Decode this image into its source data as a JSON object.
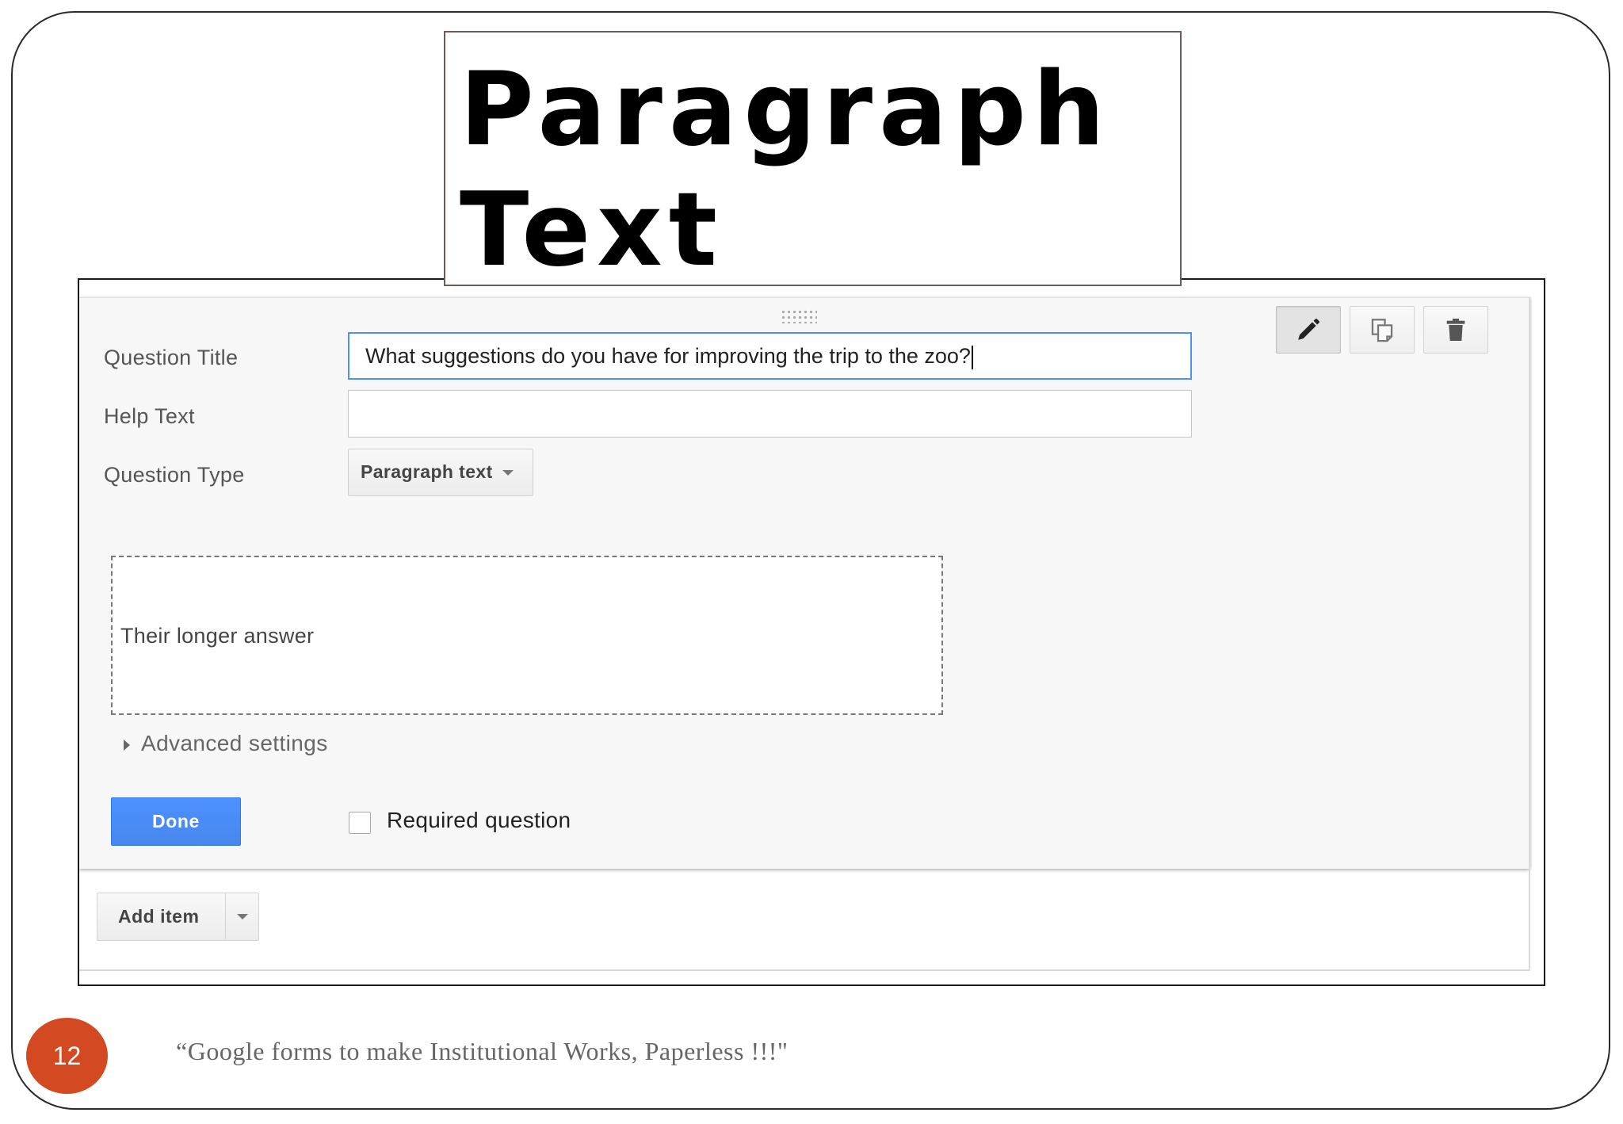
{
  "slide": {
    "title": "Paragraph\nText",
    "page_number": "12",
    "footer": "“Google forms to make Institutional Works, Paperless !!!\""
  },
  "form": {
    "question_title_label": "Question Title",
    "question_title_value": "What suggestions do you have for improving the trip to the zoo?",
    "help_text_label": "Help Text",
    "help_text_value": "",
    "question_type_label": "Question Type",
    "question_type_value": "Paragraph text",
    "answer_preview": "Their longer answer",
    "advanced_settings": "Advanced settings",
    "done_button": "Done",
    "required_label": "Required question",
    "add_item_button": "Add item"
  },
  "icons": {
    "edit": "pencil-icon",
    "duplicate": "copy-icon",
    "delete": "trash-icon"
  },
  "colors": {
    "accent": "#4d90fe",
    "badge": "#d34a22"
  }
}
